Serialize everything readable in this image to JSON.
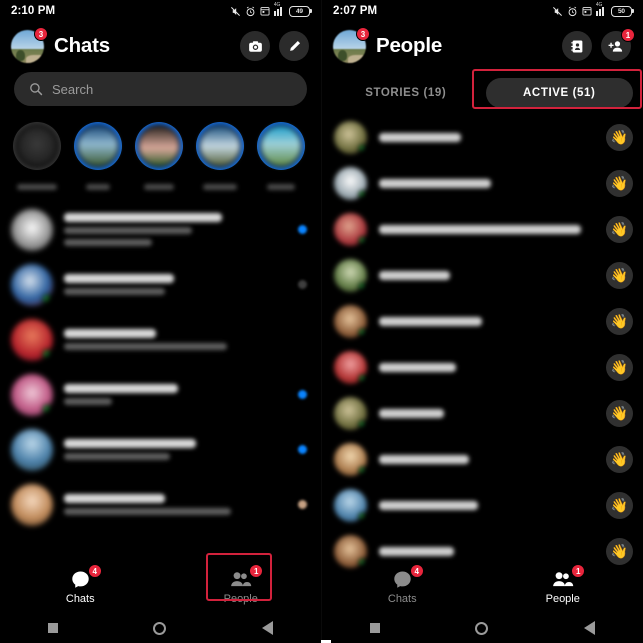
{
  "left_panel": {
    "status_bar": {
      "time": "2:10 PM",
      "battery": "49",
      "icons": [
        "mute-icon",
        "alarm-icon",
        "calendar-icon",
        "signal-4g-icon",
        "battery-icon"
      ]
    },
    "header": {
      "title": "Chats",
      "avatar_badge": "3",
      "camera_label": "camera-button",
      "compose_label": "compose-button"
    },
    "search": {
      "placeholder": "Search"
    },
    "stories": [
      {
        "has_ring": false,
        "label": ""
      },
      {
        "has_ring": true,
        "label": ""
      },
      {
        "has_ring": true,
        "label": ""
      },
      {
        "has_ring": true,
        "label": ""
      },
      {
        "has_ring": true,
        "label": ""
      }
    ],
    "chats": [
      {
        "name_w": 72,
        "msg_w": 58,
        "time_w": 0,
        "mark": "blue",
        "online": false,
        "av": "white"
      },
      {
        "name_w": 50,
        "msg_w": 46,
        "time_w": 0,
        "mark": "gray",
        "online": true,
        "av": "blue"
      },
      {
        "name_w": 42,
        "msg_w": 74,
        "time_w": 0,
        "mark": "none",
        "online": true,
        "av": "red"
      },
      {
        "name_w": 52,
        "msg_w": 22,
        "time_w": 0,
        "mark": "blue",
        "online": true,
        "av": "pink"
      },
      {
        "name_w": 60,
        "msg_w": 48,
        "time_w": 0,
        "mark": "blue",
        "online": false,
        "av": "sky"
      },
      {
        "name_w": 46,
        "msg_w": 76,
        "time_w": 0,
        "mark": "tan",
        "online": false,
        "av": "tan"
      }
    ],
    "bottom_nav": [
      {
        "label": "Chats",
        "badge": "4",
        "active": true,
        "icon": "chat-bubble-icon"
      },
      {
        "label": "People",
        "badge": "1",
        "active": false,
        "icon": "people-icon"
      }
    ],
    "highlight": {
      "target": "people-nav-button",
      "color": "#d2223c"
    }
  },
  "right_panel": {
    "status_bar": {
      "time": "2:07 PM",
      "battery": "50",
      "icons": [
        "mute-icon",
        "alarm-icon",
        "calendar-icon",
        "signal-4g-icon",
        "battery-icon"
      ]
    },
    "header": {
      "title": "People",
      "avatar_badge": "3",
      "contacts_label": "contacts-book-button",
      "add_person_label": "add-person-button",
      "add_person_badge": "1"
    },
    "tabs": [
      {
        "label": "STORIES (19)",
        "active": false
      },
      {
        "label": "ACTIVE (51)",
        "active": true
      }
    ],
    "people": [
      {
        "name_w": 66,
        "online": true,
        "av": "olive"
      },
      {
        "name_w": 96,
        "online": true,
        "av": "white"
      },
      {
        "name_w": 205,
        "online": true,
        "av": "red"
      },
      {
        "name_w": 58,
        "online": true,
        "av": "green"
      },
      {
        "name_w": 88,
        "online": true,
        "av": "brown"
      },
      {
        "name_w": 62,
        "online": true,
        "av": "red2"
      },
      {
        "name_w": 52,
        "online": true,
        "av": "olive"
      },
      {
        "name_w": 74,
        "online": true,
        "av": "tan"
      },
      {
        "name_w": 80,
        "online": true,
        "av": "sky"
      },
      {
        "name_w": 60,
        "online": true,
        "av": "brown"
      }
    ],
    "wave_icon": "👋",
    "bottom_nav": [
      {
        "label": "Chats",
        "badge": "4",
        "active": false,
        "icon": "chat-bubble-icon"
      },
      {
        "label": "People",
        "badge": "1",
        "active": true,
        "icon": "people-icon"
      }
    ],
    "highlight": {
      "target": "active-tab",
      "color": "#d2223c"
    }
  },
  "system_nav": {
    "recent": "recents-button",
    "home": "home-button",
    "back": "back-button"
  }
}
